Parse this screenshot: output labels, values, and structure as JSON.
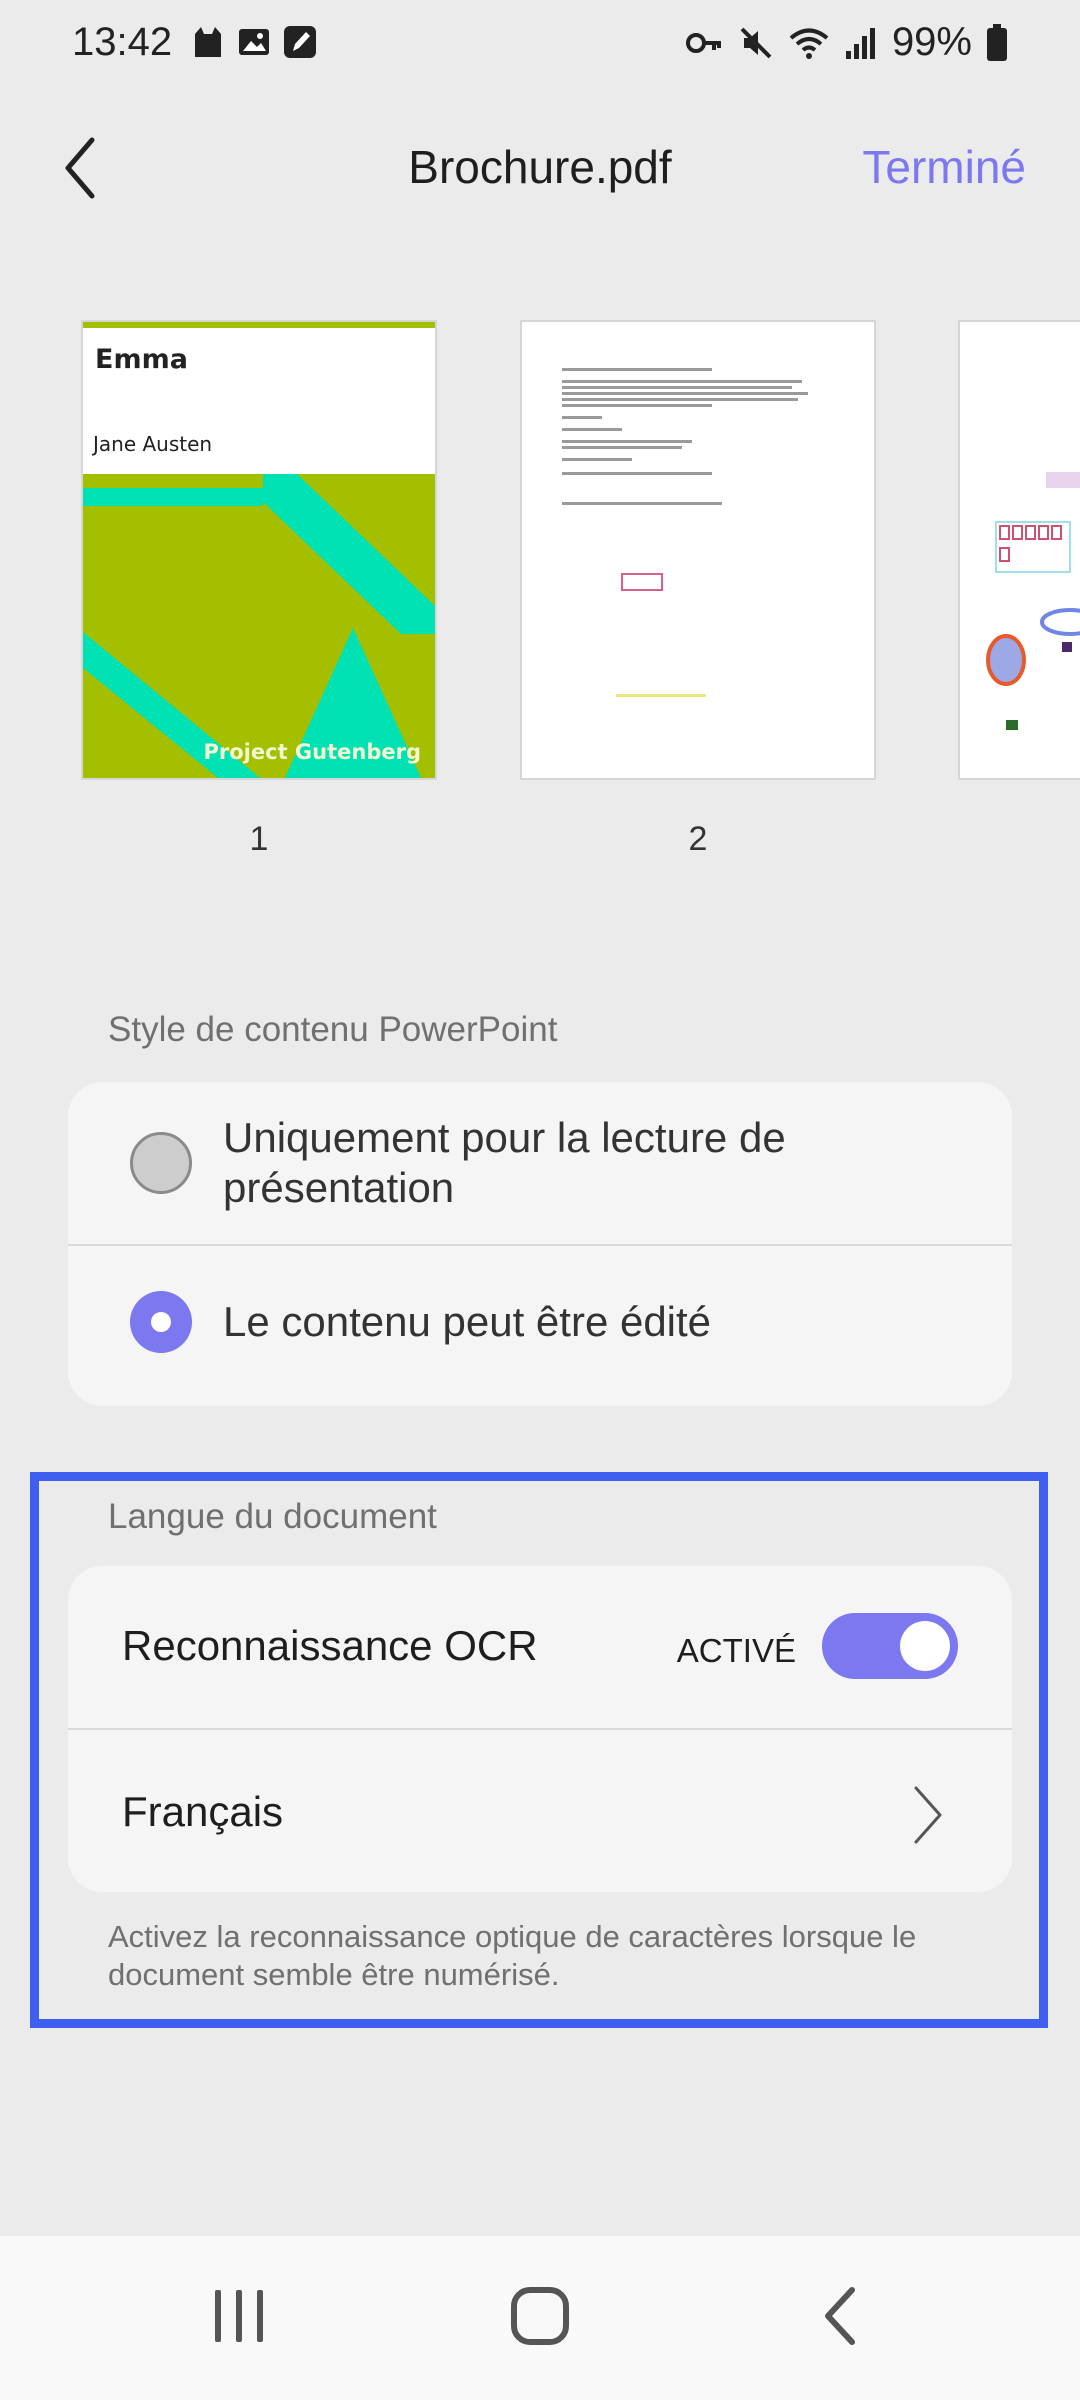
{
  "status_bar": {
    "time": "13:42",
    "battery": "99%",
    "notification_icons": [
      "cat-icon",
      "image-icon",
      "pen-icon"
    ],
    "system_icons": [
      "key-icon",
      "mute-icon",
      "wifi-icon",
      "signal-icon",
      "battery-icon"
    ]
  },
  "header": {
    "title": "Brochure.pdf",
    "done_label": "Terminé"
  },
  "thumbnails": [
    {
      "page": "1",
      "cover_title": "Emma",
      "cover_author": "Jane Austen",
      "cover_publisher": "Project Gutenberg"
    },
    {
      "page": "2"
    },
    {
      "page": ""
    }
  ],
  "powerpoint_style": {
    "section_label": "Style de contenu PowerPoint",
    "options": [
      {
        "label": "Uniquement pour la lecture de présentation",
        "selected": false
      },
      {
        "label": "Le contenu peut être édité",
        "selected": true
      }
    ]
  },
  "document_language": {
    "section_label": "Langue du document",
    "ocr_label": "Reconnaissance OCR",
    "ocr_state": "ACTIVÉ",
    "ocr_enabled": true,
    "language": "Français",
    "hint": "Activez la reconnaissance optique de caractères lorsque le document semble être numérisé."
  },
  "colors": {
    "accent": "#7b78f0",
    "highlight": "#3f5ff0",
    "cover_green": "#a4bf00",
    "cover_teal": "#00e2b4"
  }
}
